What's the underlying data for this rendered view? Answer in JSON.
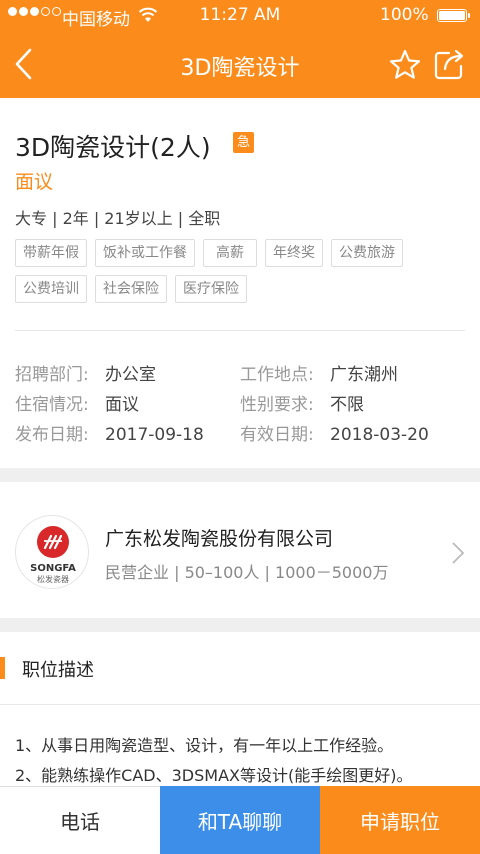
{
  "status_bar": {
    "carrier": "中国移动",
    "time": "11:27 AM",
    "battery": "100%",
    "signal_bars_filled": 3,
    "signal_bars_total": 5
  },
  "nav": {
    "title": "3D陶瓷设计",
    "back_icon": "chevron-left-icon",
    "favorite_icon": "star-icon",
    "share_icon": "share-icon"
  },
  "job": {
    "title": "3D陶瓷设计(2人)",
    "urgent_badge": "急",
    "salary": "面议",
    "requirements": "大专 | 2年 | 21岁以上 | 全职",
    "tags": [
      "带薪年假",
      "饭补或工作餐",
      "高薪",
      "年终奖",
      "公费旅游",
      "公费培训",
      "社会保险",
      "医疗保险"
    ],
    "details": [
      {
        "label": "招聘部门:",
        "value": "办公室"
      },
      {
        "label": "工作地点:",
        "value": "广东潮州"
      },
      {
        "label": "住宿情况:",
        "value": "面议"
      },
      {
        "label": "性别要求:",
        "value": "不限"
      },
      {
        "label": "发布日期:",
        "value": "2017-09-18"
      },
      {
        "label": "有效日期:",
        "value": "2018-03-20"
      }
    ]
  },
  "company": {
    "logo_en": "SONGFA",
    "logo_zh": "松发瓷器",
    "name": "广东松发陶瓷股份有限公司",
    "meta": "民营企业 | 50–100人 | 1000－5000万"
  },
  "description": {
    "heading": "职位描述",
    "lines": [
      "1、从事日用陶瓷造型、设计，有一年以上工作经验。",
      "2、能熟练操作CAD、3DSMAX等设计(能手绘图更好)。"
    ]
  },
  "actions": {
    "call": "电话",
    "chat": "和TA聊聊",
    "apply": "申请职位"
  },
  "colors": {
    "brand_orange": "#fb8c1c",
    "chat_blue": "#3d8ee8"
  }
}
